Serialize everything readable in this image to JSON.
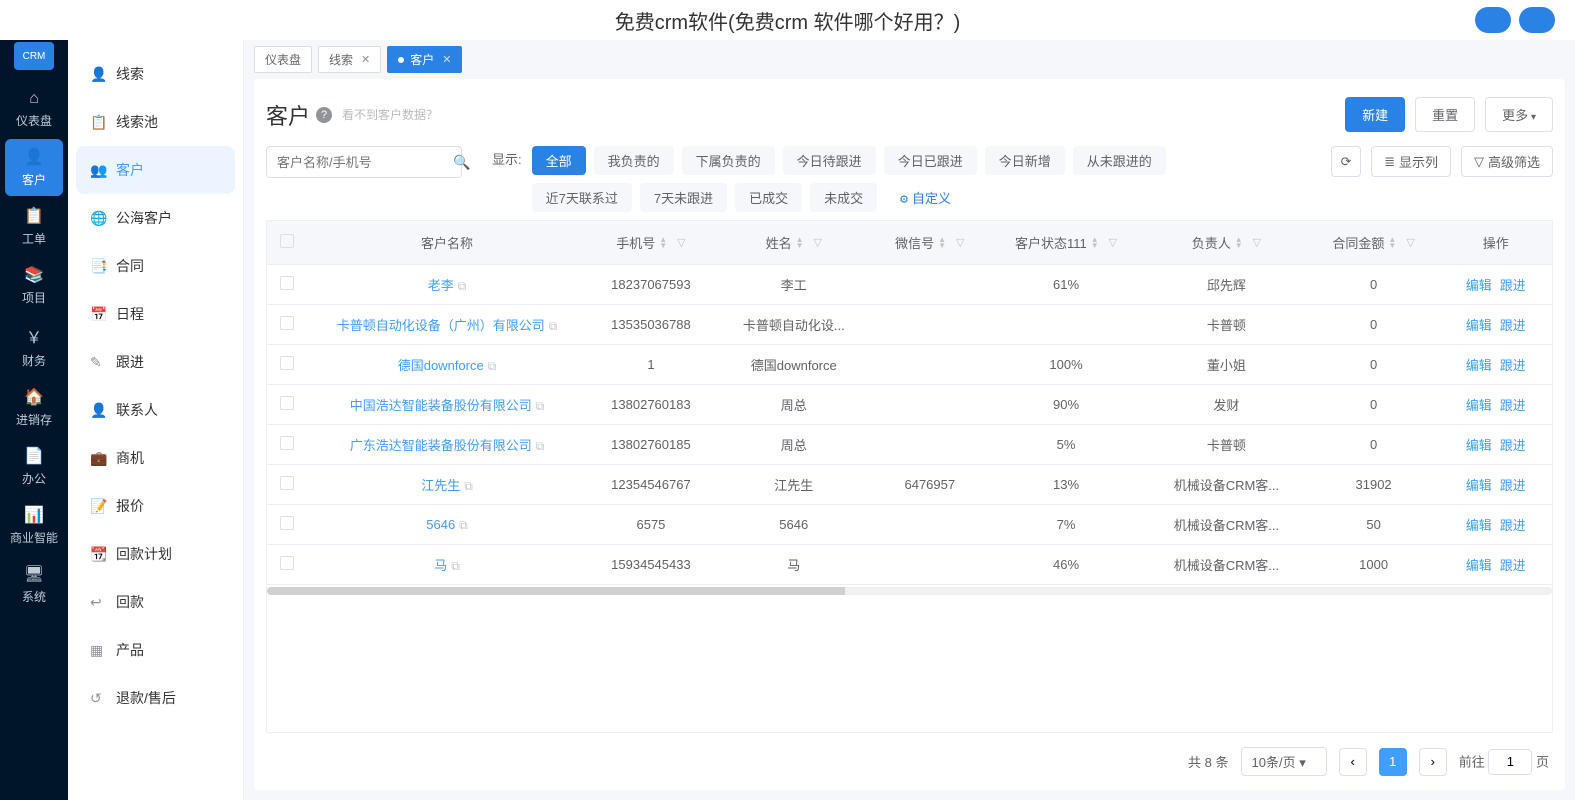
{
  "page_title": "免费crm软件(免费crm 软件哪个好用？)",
  "logo_text": "CRM",
  "side_nav": [
    {
      "icon": "⌂",
      "label": "仪表盘"
    },
    {
      "icon": "👤",
      "label": "客户"
    },
    {
      "icon": "📋",
      "label": "工单"
    },
    {
      "icon": "📚",
      "label": "项目"
    },
    {
      "icon": "￥",
      "label": "财务"
    },
    {
      "icon": "🏠",
      "label": "进销存"
    },
    {
      "icon": "📄",
      "label": "办公"
    },
    {
      "icon": "📊",
      "label": "商业智能"
    },
    {
      "icon": "🖥",
      "label": "系统"
    }
  ],
  "side_active_index": 1,
  "sub_nav": [
    {
      "icon": "👤",
      "label": "线索"
    },
    {
      "icon": "📋",
      "label": "线索池"
    },
    {
      "icon": "👥",
      "label": "客户"
    },
    {
      "icon": "🌐",
      "label": "公海客户"
    },
    {
      "icon": "📑",
      "label": "合同"
    },
    {
      "icon": "📅",
      "label": "日程"
    },
    {
      "icon": "✎",
      "label": "跟进"
    },
    {
      "icon": "👤",
      "label": "联系人"
    },
    {
      "icon": "💼",
      "label": "商机"
    },
    {
      "icon": "📝",
      "label": "报价"
    },
    {
      "icon": "📆",
      "label": "回款计划"
    },
    {
      "icon": "↩",
      "label": "回款"
    },
    {
      "icon": "▦",
      "label": "产品"
    },
    {
      "icon": "↺",
      "label": "退款/售后"
    }
  ],
  "sub_active_index": 2,
  "tabs": [
    {
      "label": "仪表盘",
      "closable": false,
      "active": false
    },
    {
      "label": "线索",
      "closable": true,
      "active": false
    },
    {
      "label": "客户",
      "closable": true,
      "active": true
    }
  ],
  "panel": {
    "title": "客户",
    "empty_hint": "看不到客户数据？",
    "actions": {
      "new": "新建",
      "reset": "重置",
      "more": "更多"
    }
  },
  "search_placeholder": "客户名称/手机号",
  "filter_label": "显示:",
  "filter_chips_row1": [
    "全部",
    "我负责的",
    "下属负责的",
    "今日待跟进",
    "今日已跟进",
    "今日新增",
    "从未跟进的",
    "近7天联系过"
  ],
  "filter_chips_row2": [
    "7天未跟进",
    "已成交",
    "未成交"
  ],
  "filter_custom": "自定义",
  "filter_active_index": 0,
  "right_tools": {
    "refresh": "⟳",
    "columns": "显示列",
    "advanced": "高级筛选"
  },
  "columns": [
    "",
    "客户名称",
    "手机号",
    "姓名",
    "微信号",
    "客户状态111",
    "负责人",
    "合同金额",
    "操作"
  ],
  "rows": [
    {
      "name": "老李",
      "phone": "18237067593",
      "contact": "李工",
      "wechat": "",
      "status": "61%",
      "owner": "邱先辉",
      "amount": "0"
    },
    {
      "name": "卡普顿自动化设备（广州）有限公司",
      "phone": "13535036788",
      "contact": "卡普顿自动化设...",
      "wechat": "",
      "status": "",
      "owner": "卡普顿",
      "amount": "0"
    },
    {
      "name": "德国downforce",
      "phone": "1",
      "contact": "德国downforce",
      "wechat": "",
      "status": "100%",
      "owner": "董小姐",
      "amount": "0"
    },
    {
      "name": "中国浩达智能装备股份有限公司",
      "phone": "13802760183",
      "contact": "周总",
      "wechat": "",
      "status": "90%",
      "owner": "发财",
      "amount": "0"
    },
    {
      "name": "广东浩达智能装备股份有限公司",
      "phone": "13802760185",
      "contact": "周总",
      "wechat": "",
      "status": "5%",
      "owner": "卡普顿",
      "amount": "0"
    },
    {
      "name": "江先生",
      "phone": "12354546767",
      "contact": "江先生",
      "wechat": "6476957",
      "status": "13%",
      "owner": "机械设备CRM客...",
      "amount": "31902"
    },
    {
      "name": "5646",
      "phone": "6575",
      "contact": "5646",
      "wechat": "",
      "status": "7%",
      "owner": "机械设备CRM客...",
      "amount": "50"
    },
    {
      "name": "马",
      "phone": "15934545433",
      "contact": "马",
      "wechat": "",
      "status": "46%",
      "owner": "机械设备CRM客...",
      "amount": "1000"
    }
  ],
  "op": {
    "edit": "编辑",
    "follow": "跟进"
  },
  "pagination": {
    "total_text": "共 8 条",
    "per_page": "10条/页",
    "current": "1",
    "goto_label": "前往",
    "goto_value": "1",
    "page_suffix": "页"
  }
}
